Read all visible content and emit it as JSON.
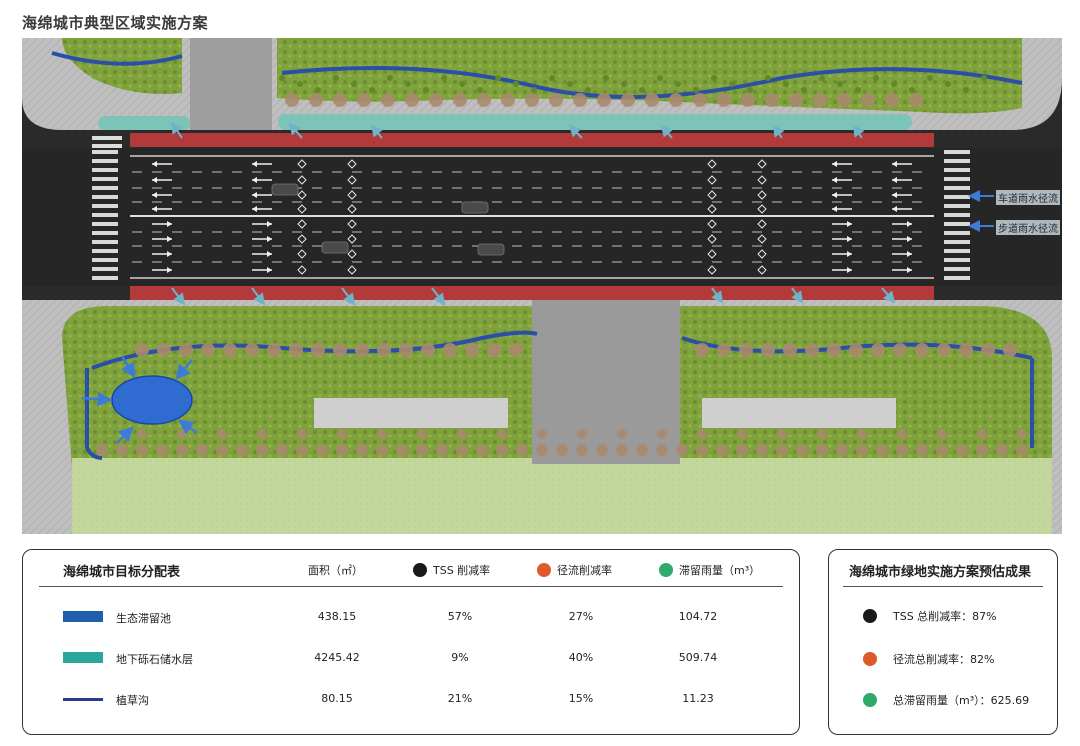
{
  "page": {
    "title": "海绵城市典型区域实施方案"
  },
  "plan": {
    "labels": {
      "road_runoff": "车道雨水径流",
      "sidewalk_runoff": "步道雨水径流"
    }
  },
  "allocation_table": {
    "title": "海绵城市目标分配表",
    "headers": {
      "area": "面积（㎡）",
      "tss": "TSS 削减率",
      "runoff": "径流削减率",
      "retention": "滞留雨量（m³）"
    },
    "header_colors": {
      "tss": "#1a1a1a",
      "runoff": "#dd5a2b",
      "retention": "#2eaa6a"
    },
    "rows": [
      {
        "name": "生态滞留池",
        "swatch": "#1f5fae",
        "swatch_type": "block",
        "area": "438.15",
        "tss": "57%",
        "runoff": "27%",
        "retention": "104.72"
      },
      {
        "name": "地下砾石储水层",
        "swatch": "#2aa79c",
        "swatch_type": "block",
        "area": "4245.42",
        "tss": "9%",
        "runoff": "40%",
        "retention": "509.74"
      },
      {
        "name": "植草沟",
        "swatch": "#2b3a8c",
        "swatch_type": "line",
        "area": "80.15",
        "tss": "21%",
        "runoff": "15%",
        "retention": "11.23"
      }
    ]
  },
  "results": {
    "title": "海绵城市绿地实施方案预估成果",
    "items": [
      {
        "color": "#1a1a1a",
        "text": "TSS 总削减率：87%"
      },
      {
        "color": "#dd5a2b",
        "text": "径流总削减率：82%"
      },
      {
        "color": "#2eaa6a",
        "text": "总滞留雨量（m³）：625.69"
      }
    ]
  }
}
